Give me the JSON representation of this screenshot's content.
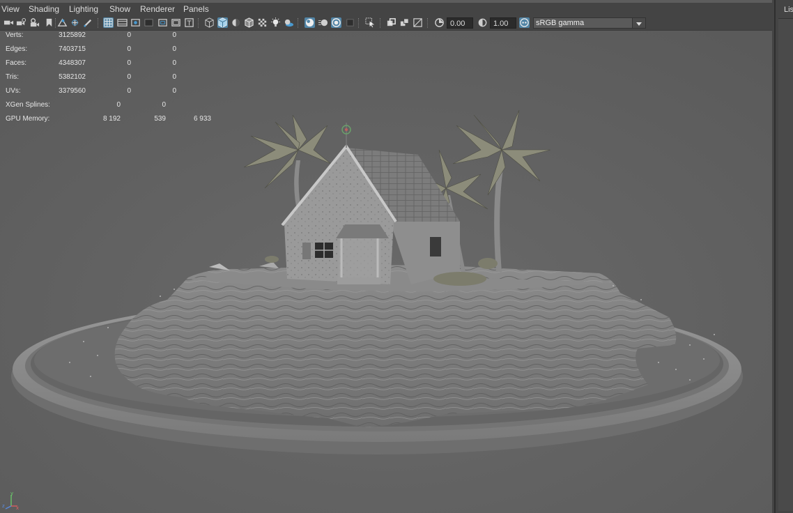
{
  "menu": [
    "View",
    "Shading",
    "Lighting",
    "Show",
    "Renderer",
    "Panels"
  ],
  "toolbar": {
    "exposure": "0.00",
    "gamma": "1.00",
    "color_management": "sRGB gamma",
    "icons": [
      "select-camera-icon",
      "camera-attributes-icon",
      "bookmarks-icon",
      "image-plane-icon",
      "film-gate-icon",
      "resolution-gate-icon",
      "grid-icon",
      "wireframe-icon",
      "smooth-shade-icon",
      "textured-icon",
      "lights-icon",
      "shadows-icon",
      "isolate-select-icon",
      "xray-icon",
      "exposure-icon",
      "gamma-icon",
      "color-management-icon"
    ]
  },
  "hud": {
    "rows": [
      {
        "label": "Verts:",
        "v1": "3125892",
        "v2": "0",
        "v3": "0"
      },
      {
        "label": "Edges:",
        "v1": "7403715",
        "v2": "0",
        "v3": "0"
      },
      {
        "label": "Faces:",
        "v1": "4348307",
        "v2": "0",
        "v3": "0"
      },
      {
        "label": "Tris:",
        "v1": "5382102",
        "v2": "0",
        "v3": "0"
      },
      {
        "label": "UVs:",
        "v1": "3379560",
        "v2": "0",
        "v3": "0"
      }
    ],
    "xgen": {
      "label": "XGen Splines:",
      "v1": "0",
      "v2": "0"
    },
    "gpu": {
      "label": "GPU Memory:",
      "v1": "8 192",
      "v2": "539",
      "v3": "6 933"
    }
  },
  "right_panel": {
    "tab": "Lis"
  },
  "axis": {
    "y": "y",
    "z": "z",
    "x": "x"
  },
  "colors": {
    "accent": "#5285a6",
    "viewport_bg": "#5d5d5d",
    "ui_bg": "#444444"
  }
}
